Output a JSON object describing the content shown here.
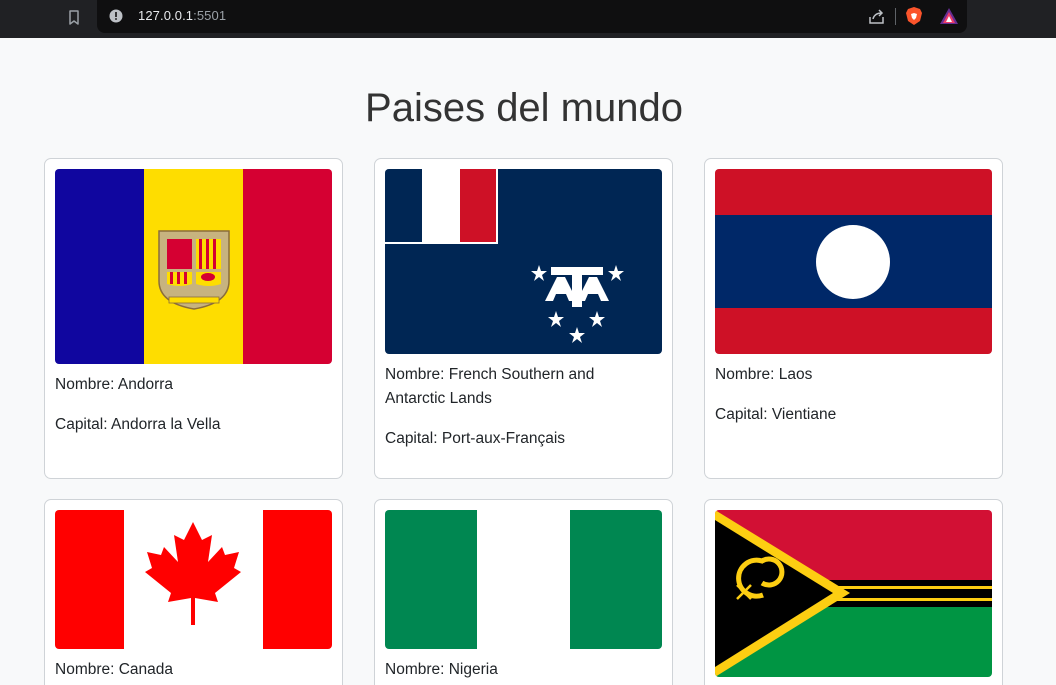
{
  "browser": {
    "url_host": "127.0.0.1",
    "url_port": ":5501",
    "icons": [
      "bookmark-icon",
      "info-icon",
      "share-icon",
      "brave-shield-icon",
      "brave-rewards-icon"
    ]
  },
  "page": {
    "title": "Paises del mundo"
  },
  "countries": [
    {
      "nombre": "Nombre: Andorra",
      "capital": "Capital: Andorra la Vella",
      "flag_colors": [
        "#10069f",
        "#fedd00",
        "#d50032"
      ]
    },
    {
      "nombre": "Nombre: French Southern and Antarctic Lands",
      "capital": "Capital: Port-aux-Français",
      "flag_colors": [
        "#002654",
        "#ffffff",
        "#ce1126"
      ]
    },
    {
      "nombre": "Nombre: Laos",
      "capital": "Capital: Vientiane",
      "flag_colors": [
        "#ce1126",
        "#002868",
        "#ffffff"
      ]
    },
    {
      "nombre": "Nombre: Canada",
      "capital": "",
      "flag_colors": [
        "#ff0000",
        "#ffffff"
      ]
    },
    {
      "nombre": "Nombre: Nigeria",
      "capital": "",
      "flag_colors": [
        "#008751",
        "#ffffff"
      ]
    },
    {
      "nombre": "",
      "capital": "",
      "flag_colors": [
        "#d21034",
        "#000000",
        "#fdce12",
        "#009543"
      ]
    }
  ]
}
